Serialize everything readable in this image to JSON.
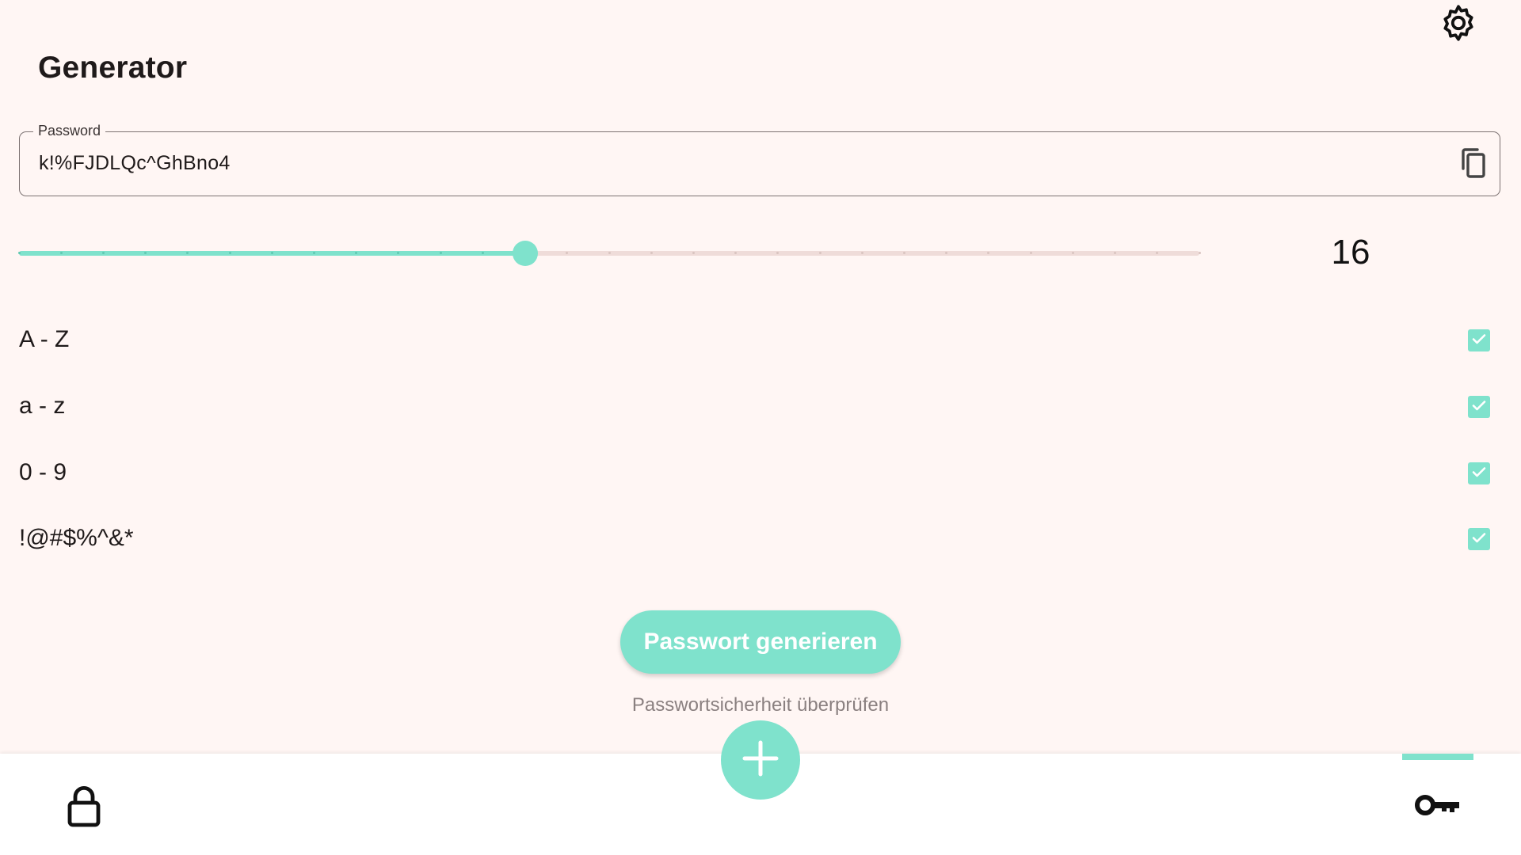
{
  "header": {
    "title": "Generator",
    "settings_icon": "gear-icon"
  },
  "password_field": {
    "label": "Password",
    "value": "k!%FJDLQc^GhBno4",
    "copy_icon": "copy-icon"
  },
  "length_slider": {
    "value": "16",
    "min": 4,
    "max": 32,
    "steps": 28,
    "current": 16
  },
  "options": [
    {
      "label": "A - Z",
      "checked": true
    },
    {
      "label": "a - z",
      "checked": true
    },
    {
      "label": "0 - 9",
      "checked": true
    },
    {
      "label": "!@#$%^&*",
      "checked": true
    }
  ],
  "actions": {
    "generate_label": "Passwort generieren",
    "check_strength_label": "Passwortsicherheit überprüfen"
  },
  "bottom_nav": {
    "left_icon": "lock-icon",
    "center_icon": "plus-icon",
    "right_icon": "key-icon",
    "active": "key"
  },
  "colors": {
    "accent": "#7fe2cc",
    "background": "#fff6f4",
    "nav_background": "#ffffff",
    "text": "#1f1a1a",
    "muted_text": "#8a8080"
  }
}
